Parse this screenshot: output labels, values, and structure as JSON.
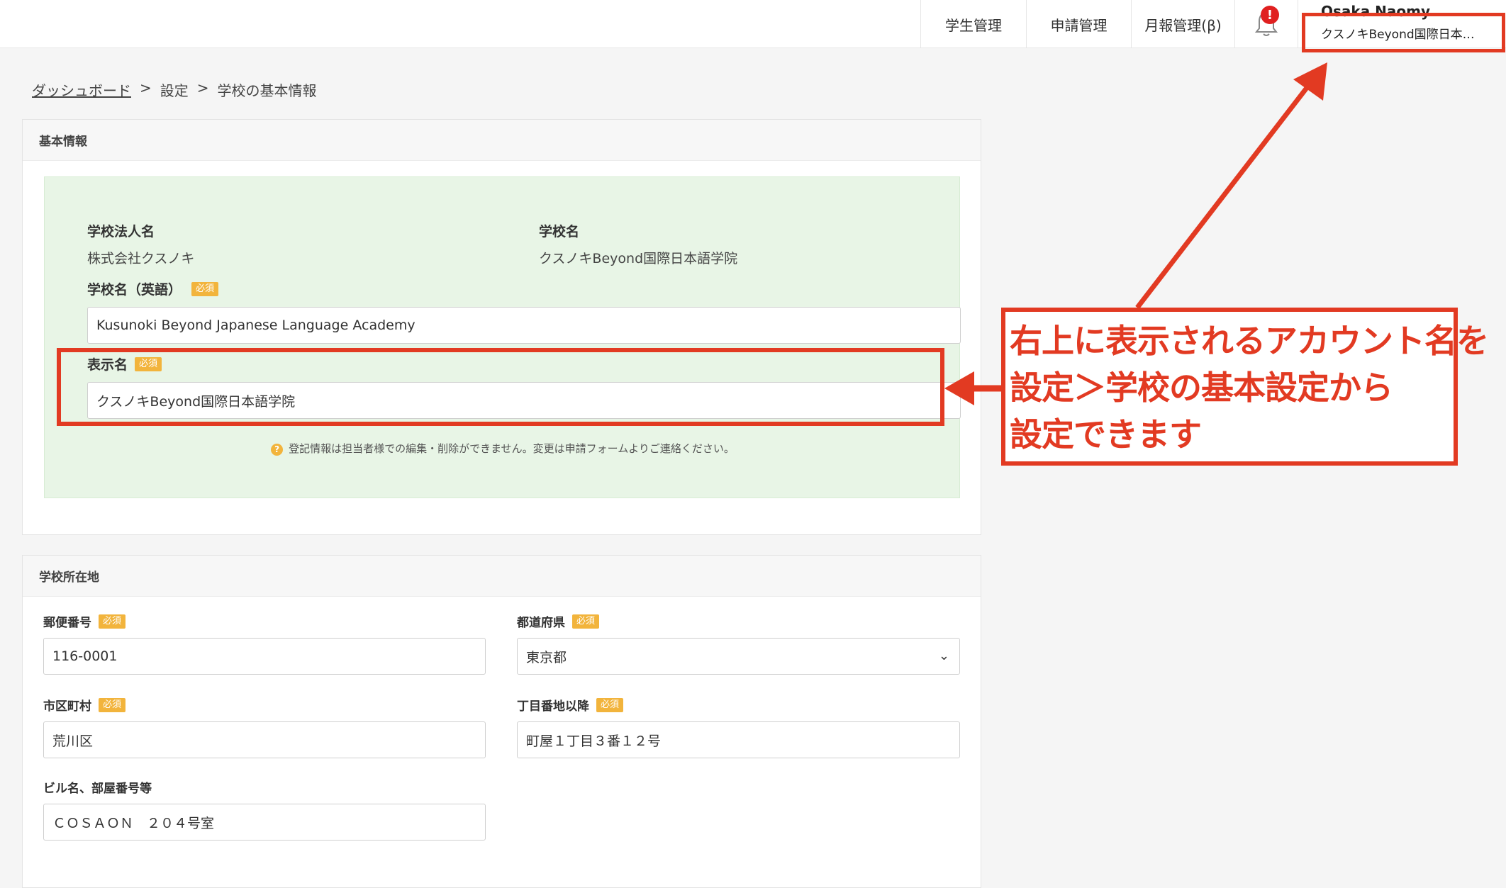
{
  "nav": {
    "items": [
      {
        "label": "学生管理"
      },
      {
        "label": "申請管理"
      },
      {
        "label": "月報管理(β)"
      }
    ],
    "alert_badge": "!",
    "account": {
      "user": "Osaka Naomy",
      "school": "クスノキBeyond国際日本…"
    }
  },
  "breadcrumb": {
    "dashboard": "ダッシュボード",
    "sep1": ">",
    "settings": "設定",
    "sep2": ">",
    "current": "学校の基本情報"
  },
  "basic_info": {
    "header": "基本情報",
    "corp_label": "学校法人名",
    "corp_value": "株式会社クスノキ",
    "school_label": "学校名",
    "school_value": "クスノキBeyond国際日本語学院",
    "english_label": "学校名（英語）",
    "english_value": "Kusunoki Beyond Japanese Language Academy",
    "display_label": "表示名",
    "display_value": "クスノキBeyond国際日本語学院",
    "required": "必須",
    "notice": "登記情報は担当者様での編集・削除ができません。変更は申請フォームよりご連絡ください。",
    "notice_icon": "?"
  },
  "address": {
    "header": "学校所在地",
    "postal_label": "郵便番号",
    "postal_value": "116-0001",
    "pref_label": "都道府県",
    "pref_value": "東京都",
    "city_label": "市区町村",
    "city_value": "荒川区",
    "street_label": "丁目番地以降",
    "street_value": "町屋１丁目３番１２号",
    "building_label": "ビル名、部屋番号等",
    "building_value": "ＣＯＳＡＯＮ　２０４号室"
  },
  "annotation": {
    "line1": "右上に表示されるアカウント名を",
    "line2": "設定＞学校の基本設定から",
    "line3": "設定できます",
    "color": "#e23a22"
  }
}
